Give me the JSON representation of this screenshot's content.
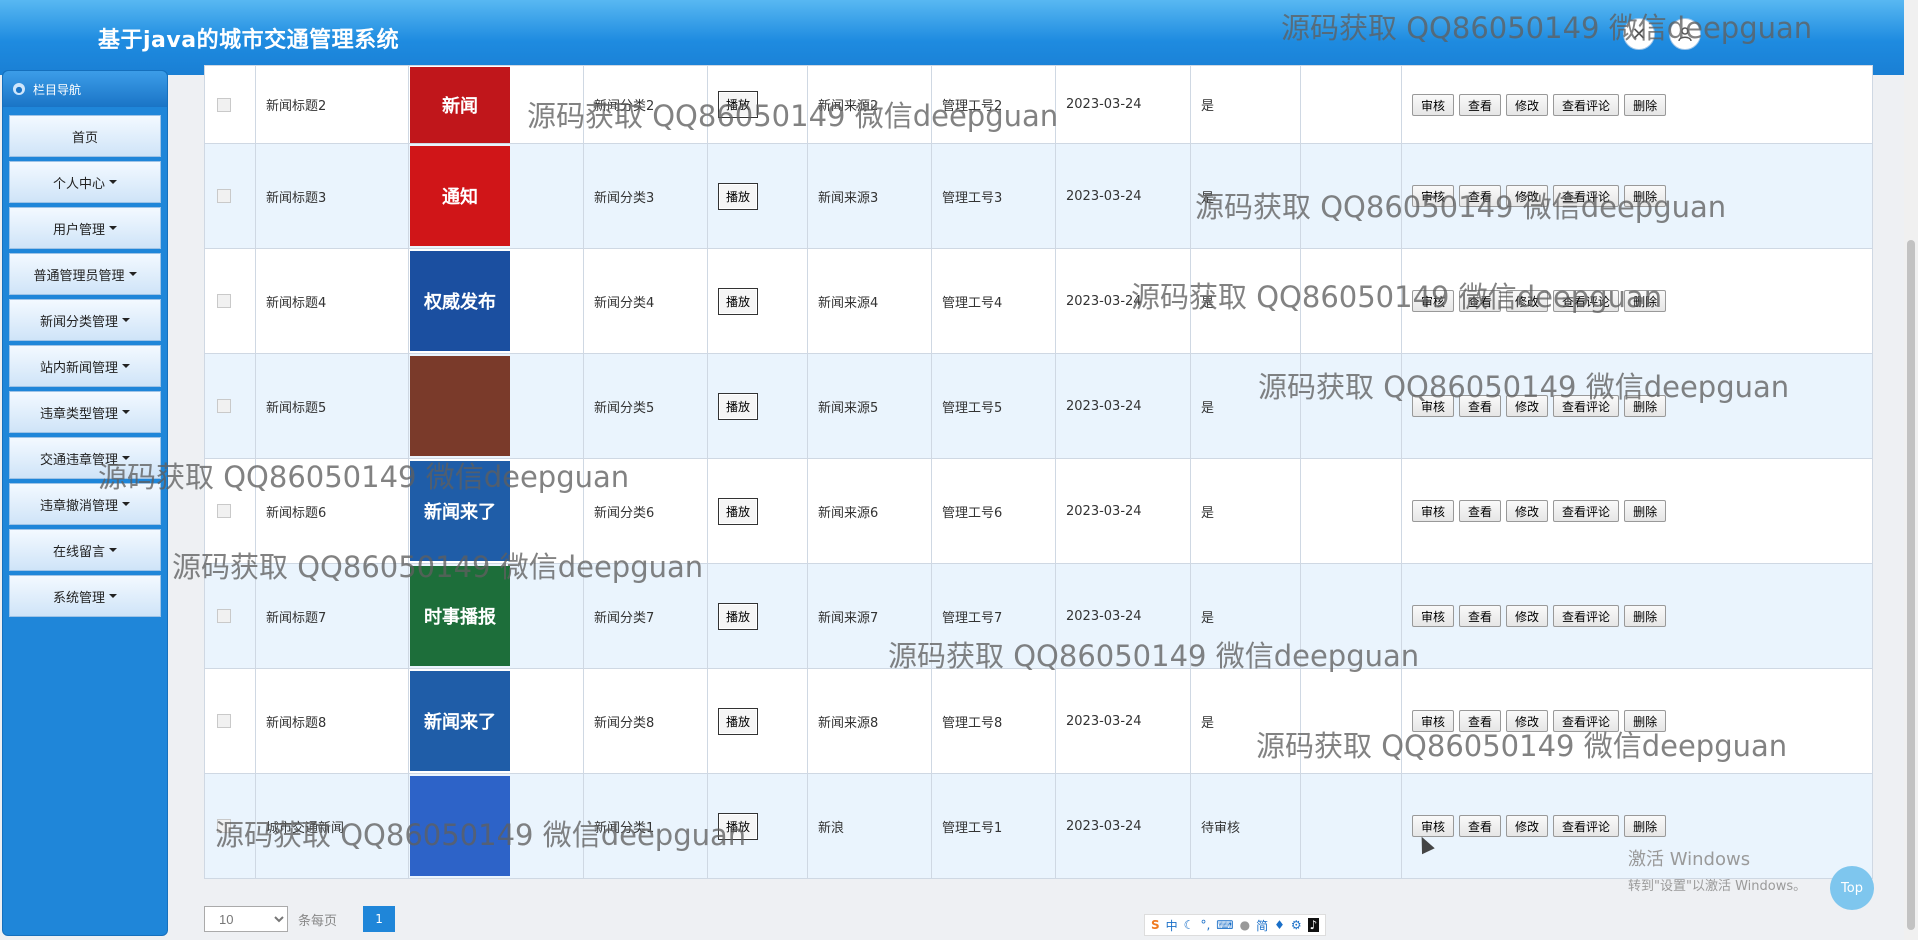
{
  "header": {
    "title": "基于java的城市交通管理系统"
  },
  "sidebar": {
    "heading": "栏目导航",
    "items": [
      {
        "label": "首页",
        "dropdown": false
      },
      {
        "label": "个人中心",
        "dropdown": true
      },
      {
        "label": "用户管理",
        "dropdown": true
      },
      {
        "label": "普通管理员管理",
        "dropdown": true
      },
      {
        "label": "新闻分类管理",
        "dropdown": true
      },
      {
        "label": "站内新闻管理",
        "dropdown": true
      },
      {
        "label": "违章类型管理",
        "dropdown": true
      },
      {
        "label": "交通违章管理",
        "dropdown": true
      },
      {
        "label": "违章撤消管理",
        "dropdown": true
      },
      {
        "label": "在线留言",
        "dropdown": true
      },
      {
        "label": "系统管理",
        "dropdown": true
      }
    ]
  },
  "table": {
    "play_label": "播放",
    "actions": [
      "审核",
      "查看",
      "修改",
      "查看评论",
      "删除"
    ],
    "rows": [
      {
        "title": "新闻标题2",
        "image": "新闻",
        "image_color": "#c0161b",
        "category": "新闻分类2",
        "source": "新闻来源2",
        "staff": "管理工号2",
        "date": "2023-03-24",
        "approved": "是"
      },
      {
        "title": "新闻标题3",
        "image": "通知",
        "image_color": "#d01518",
        "category": "新闻分类3",
        "source": "新闻来源3",
        "staff": "管理工号3",
        "date": "2023-03-24",
        "approved": "是"
      },
      {
        "title": "新闻标题4",
        "image": "权威发布",
        "image_color": "#1b4fa0",
        "category": "新闻分类4",
        "source": "新闻来源4",
        "staff": "管理工号4",
        "date": "2023-03-24",
        "approved": "是"
      },
      {
        "title": "新闻标题5",
        "image": "",
        "image_color": "#7a3a2a",
        "category": "新闻分类5",
        "source": "新闻来源5",
        "staff": "管理工号5",
        "date": "2023-03-24",
        "approved": "是"
      },
      {
        "title": "新闻标题6",
        "image": "新闻来了",
        "image_color": "#1f5da8",
        "category": "新闻分类6",
        "source": "新闻来源6",
        "staff": "管理工号6",
        "date": "2023-03-24",
        "approved": "是"
      },
      {
        "title": "新闻标题7",
        "image": "时事播报",
        "image_color": "#1d6e3a",
        "category": "新闻分类7",
        "source": "新闻来源7",
        "staff": "管理工号7",
        "date": "2023-03-24",
        "approved": "是"
      },
      {
        "title": "新闻标题8",
        "image": "新闻来了",
        "image_color": "#1f5da8",
        "category": "新闻分类8",
        "source": "新闻来源8",
        "staff": "管理工号8",
        "date": "2023-03-24",
        "approved": "是"
      },
      {
        "title": "城市交通新闻",
        "image": "",
        "image_color": "#2d63c8",
        "category": "新闻分类1",
        "source": "新浪",
        "staff": "管理工号1",
        "date": "2023-03-24",
        "approved": "待审核"
      }
    ]
  },
  "pager": {
    "page_size": "10",
    "per_page_label": "条每页",
    "current_page": "1"
  },
  "ime": {
    "items": [
      "中",
      "简"
    ]
  },
  "windows_notice": {
    "line1": "激活 Windows",
    "line2": "转到\"设置\"以激活 Windows。"
  },
  "top_button": "Top",
  "watermark": "源码获取 QQ86050149 微信deepguan"
}
